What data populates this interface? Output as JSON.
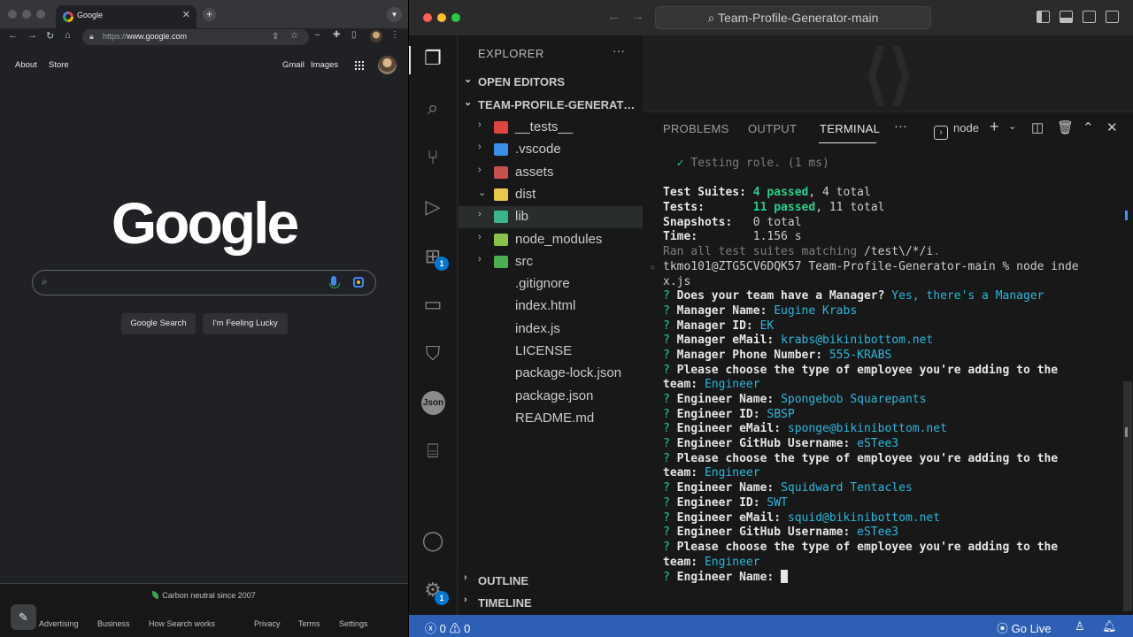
{
  "chrome": {
    "tab_title": "Google",
    "url_prefix": "https://",
    "url_domain": "www.google.com",
    "top_links": {
      "about": "About",
      "store": "Store",
      "gmail": "Gmail",
      "images": "Images"
    },
    "logo_text": "Google",
    "buttons": {
      "search": "Google Search",
      "lucky": "I'm Feeling Lucky"
    },
    "carbon": "Carbon neutral since 2007",
    "footer_links": [
      "Advertising",
      "Business",
      "How Search works",
      "Privacy",
      "Terms",
      "Settings"
    ]
  },
  "vscode": {
    "command_center": "Team-Profile-Generator-main",
    "explorer": {
      "header": "EXPLORER",
      "open_editors": "OPEN EDITORS",
      "root": "TEAM-PROFILE-GENERATOR-MAIN",
      "items": [
        {
          "name": "__tests__",
          "type": "folder",
          "icon_color": "#e0443e"
        },
        {
          "name": ".vscode",
          "type": "folder",
          "icon_color": "#3b8eea"
        },
        {
          "name": "assets",
          "type": "folder",
          "icon_color": "#c94f4f"
        },
        {
          "name": "dist",
          "type": "folder-open",
          "icon_color": "#e8c84a"
        },
        {
          "name": "lib",
          "type": "folder",
          "icon_color": "#3bb58a"
        },
        {
          "name": "node_modules",
          "type": "folder",
          "icon_color": "#8bc34a"
        },
        {
          "name": "src",
          "type": "folder",
          "icon_color": "#4caf50"
        },
        {
          "name": ".gitignore",
          "type": "file",
          "icon_color": "#e64a19"
        },
        {
          "name": "index.html",
          "type": "file",
          "icon_color": "#e44d26"
        },
        {
          "name": "index.js",
          "type": "file",
          "icon_color": "#f5de19"
        },
        {
          "name": "LICENSE",
          "type": "file",
          "icon_color": "#d4a84b"
        },
        {
          "name": "package-lock.json",
          "type": "file",
          "icon_color": "#c1272d"
        },
        {
          "name": "package.json",
          "type": "file",
          "icon_color": "#c1272d"
        },
        {
          "name": "README.md",
          "type": "file",
          "icon_color": "#7d7d7d"
        }
      ],
      "outline": "OUTLINE",
      "timeline": "TIMELINE"
    },
    "panel": {
      "tabs": [
        "PROBLEMS",
        "OUTPUT",
        "TERMINAL"
      ],
      "active_tab": "TERMINAL",
      "shell": "node"
    },
    "terminal_lines": [
      [
        {
          "t": "  ✓ ",
          "c": "t-q"
        },
        {
          "t": "Testing role. (1 ms)",
          "c": "t-dim"
        }
      ],
      [
        {
          "t": "",
          "c": ""
        }
      ],
      [
        {
          "t": "Test Suites: ",
          "c": "t-b"
        },
        {
          "t": "4 passed",
          "c": "t-g"
        },
        {
          "t": ", 4 total",
          "c": ""
        }
      ],
      [
        {
          "t": "Tests:       ",
          "c": "t-b"
        },
        {
          "t": "11 passed",
          "c": "t-g"
        },
        {
          "t": ", 11 total",
          "c": ""
        }
      ],
      [
        {
          "t": "Snapshots:   ",
          "c": "t-b"
        },
        {
          "t": "0 total",
          "c": ""
        }
      ],
      [
        {
          "t": "Time:        ",
          "c": "t-b"
        },
        {
          "t": "1.156 s",
          "c": ""
        }
      ],
      [
        {
          "t": "Ran all test suites matching ",
          "c": "t-dim"
        },
        {
          "t": "/test\\/*/i",
          "c": ""
        },
        {
          "t": ".",
          "c": "t-dim"
        }
      ],
      [
        {
          "t": "tkmo101@ZTG5CV6DQK57 Team-Profile-Generator-main % node inde",
          "c": ""
        }
      ],
      [
        {
          "t": "x.js",
          "c": ""
        }
      ],
      [
        {
          "t": "? ",
          "c": "t-q"
        },
        {
          "t": "Does your team have a Manager? ",
          "c": "t-b"
        },
        {
          "t": "Yes, there's a Manager",
          "c": "t-cy"
        }
      ],
      [
        {
          "t": "? ",
          "c": "t-q"
        },
        {
          "t": "Manager Name: ",
          "c": "t-b"
        },
        {
          "t": "Eugine Krabs",
          "c": "t-cy"
        }
      ],
      [
        {
          "t": "? ",
          "c": "t-q"
        },
        {
          "t": "Manager ID: ",
          "c": "t-b"
        },
        {
          "t": "EK",
          "c": "t-cy"
        }
      ],
      [
        {
          "t": "? ",
          "c": "t-q"
        },
        {
          "t": "Manager eMail: ",
          "c": "t-b"
        },
        {
          "t": "krabs@bikinibottom.net",
          "c": "t-cy"
        }
      ],
      [
        {
          "t": "? ",
          "c": "t-q"
        },
        {
          "t": "Manager Phone Number: ",
          "c": "t-b"
        },
        {
          "t": "555-KRABS",
          "c": "t-cy"
        }
      ],
      [
        {
          "t": "? ",
          "c": "t-q"
        },
        {
          "t": "Please choose the type of employee you're adding to the",
          "c": "t-b"
        }
      ],
      [
        {
          "t": "team: ",
          "c": "t-b"
        },
        {
          "t": "Engineer",
          "c": "t-cy"
        }
      ],
      [
        {
          "t": "? ",
          "c": "t-q"
        },
        {
          "t": "Engineer Name: ",
          "c": "t-b"
        },
        {
          "t": "Spongebob Squarepants",
          "c": "t-cy"
        }
      ],
      [
        {
          "t": "? ",
          "c": "t-q"
        },
        {
          "t": "Engineer ID: ",
          "c": "t-b"
        },
        {
          "t": "SBSP",
          "c": "t-cy"
        }
      ],
      [
        {
          "t": "? ",
          "c": "t-q"
        },
        {
          "t": "Engineer eMail: ",
          "c": "t-b"
        },
        {
          "t": "sponge@bikinibottom.net",
          "c": "t-cy"
        }
      ],
      [
        {
          "t": "? ",
          "c": "t-q"
        },
        {
          "t": "Engineer GitHub Username: ",
          "c": "t-b"
        },
        {
          "t": "eSTee3",
          "c": "t-cy"
        }
      ],
      [
        {
          "t": "? ",
          "c": "t-q"
        },
        {
          "t": "Please choose the type of employee you're adding to the",
          "c": "t-b"
        }
      ],
      [
        {
          "t": "team: ",
          "c": "t-b"
        },
        {
          "t": "Engineer",
          "c": "t-cy"
        }
      ],
      [
        {
          "t": "? ",
          "c": "t-q"
        },
        {
          "t": "Engineer Name: ",
          "c": "t-b"
        },
        {
          "t": "Squidward Tentacles",
          "c": "t-cy"
        }
      ],
      [
        {
          "t": "? ",
          "c": "t-q"
        },
        {
          "t": "Engineer ID: ",
          "c": "t-b"
        },
        {
          "t": "SWT",
          "c": "t-cy"
        }
      ],
      [
        {
          "t": "? ",
          "c": "t-q"
        },
        {
          "t": "Engineer eMail: ",
          "c": "t-b"
        },
        {
          "t": "squid@bikinibottom.net",
          "c": "t-cy"
        }
      ],
      [
        {
          "t": "? ",
          "c": "t-q"
        },
        {
          "t": "Engineer GitHub Username: ",
          "c": "t-b"
        },
        {
          "t": "eSTee3",
          "c": "t-cy"
        }
      ],
      [
        {
          "t": "? ",
          "c": "t-q"
        },
        {
          "t": "Please choose the type of employee you're adding to the",
          "c": "t-b"
        }
      ],
      [
        {
          "t": "team: ",
          "c": "t-b"
        },
        {
          "t": "Engineer",
          "c": "t-cy"
        }
      ],
      [
        {
          "t": "? ",
          "c": "t-q"
        },
        {
          "t": "Engineer Name: ",
          "c": "t-b"
        }
      ]
    ],
    "status_bar": {
      "errors": "0",
      "warnings": "0",
      "go_live": "Go Live"
    },
    "badges": {
      "extensions": "1",
      "settings": "1"
    },
    "colors": {
      "status_bar": "#2d5fb5",
      "accent": "#0078d4"
    }
  }
}
